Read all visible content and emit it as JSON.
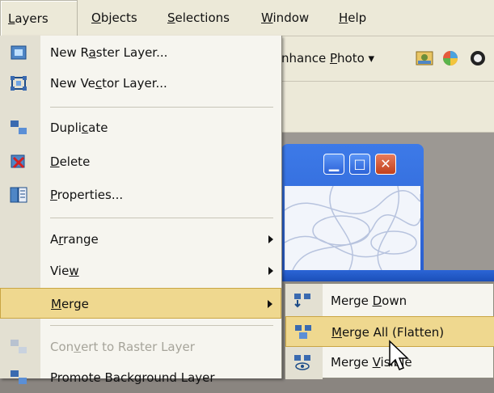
{
  "menubar": {
    "items": [
      {
        "pre": "",
        "u": "L",
        "post": "ayers"
      },
      {
        "pre": "",
        "u": "O",
        "post": "bjects"
      },
      {
        "pre": "",
        "u": "S",
        "post": "elections"
      },
      {
        "pre": "",
        "u": "W",
        "post": "indow"
      },
      {
        "pre": "",
        "u": "H",
        "post": "elp"
      }
    ]
  },
  "toolbar": {
    "enhance_pre": "nhance ",
    "enhance_u": "P",
    "enhance_post": "hoto",
    "dropdown_glyph": "▾"
  },
  "child_window": {
    "minimize_glyph": "▁",
    "maximize_glyph": "□",
    "close_glyph": "✕"
  },
  "layers_menu": {
    "items": [
      {
        "pre": "New R",
        "u": "a",
        "post": "ster Layer..."
      },
      {
        "pre": "New Ve",
        "u": "c",
        "post": "tor Layer..."
      },
      {
        "pre": "Dupli",
        "u": "c",
        "post": "ate"
      },
      {
        "pre": "",
        "u": "D",
        "post": "elete"
      },
      {
        "pre": "",
        "u": "P",
        "post": "roperties..."
      },
      {
        "pre": "A",
        "u": "r",
        "post": "range"
      },
      {
        "pre": "Vie",
        "u": "w",
        "post": ""
      },
      {
        "pre": "",
        "u": "M",
        "post": "erge"
      },
      {
        "pre": "Con",
        "u": "v",
        "post": "ert to Raster Layer"
      },
      {
        "pre": "Promote Background Layer",
        "u": "",
        "post": ""
      }
    ]
  },
  "merge_submenu": {
    "items": [
      {
        "pre": "Merge ",
        "u": "D",
        "post": "own"
      },
      {
        "pre": "",
        "u": "M",
        "post": "erge All (Flatten)"
      },
      {
        "pre": "Merge ",
        "u": "V",
        "post": "isible"
      }
    ]
  },
  "colors": {
    "highlight": "#efd88f",
    "menubar": "#ece9d8",
    "titlebar_blue": "#2a5fd0"
  }
}
